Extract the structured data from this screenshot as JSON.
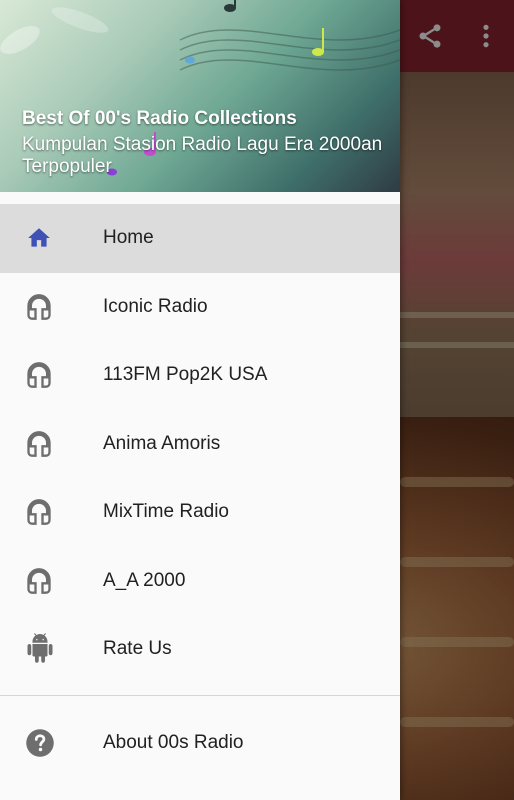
{
  "header": {
    "title": "Best Of 00's Radio Collections",
    "subtitle": "Kumpulan Stasion Radio Lagu Era 2000an Terpopuler"
  },
  "toolbar": {
    "share_icon": "share-icon",
    "overflow_icon": "overflow-menu-icon",
    "color": "#8a2530"
  },
  "menu": {
    "items": [
      {
        "label": "Home",
        "icon": "home-icon",
        "selected": true
      },
      {
        "label": "Iconic Radio",
        "icon": "headphones-icon"
      },
      {
        "label": "113FM Pop2K USA",
        "icon": "headphones-icon"
      },
      {
        "label": "Anima Amoris",
        "icon": "headphones-icon"
      },
      {
        "label": "MixTime Radio",
        "icon": "headphones-icon"
      },
      {
        "label": "A_A 2000",
        "icon": "headphones-icon"
      },
      {
        "label": "Rate Us",
        "icon": "android-icon"
      }
    ],
    "footer_item": {
      "label": "About 00s Radio",
      "icon": "help-icon"
    }
  },
  "colors": {
    "accent": "#3f51b5",
    "icon_gray": "#6e6e6e",
    "selected_bg": "#dcdcdc"
  }
}
